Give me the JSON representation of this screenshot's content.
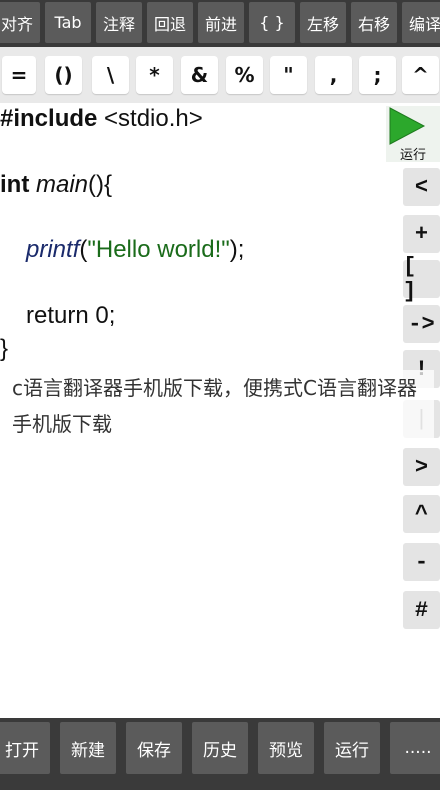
{
  "toolbar": {
    "items": [
      "对齐",
      "Tab",
      "注释",
      "回退",
      "前进",
      "{ }",
      "左移",
      "右移",
      "编译"
    ]
  },
  "symbols": [
    "=",
    "()",
    "\\",
    "*",
    "&",
    "%",
    "\"",
    ",",
    ";",
    "^"
  ],
  "code": {
    "line1_kw": "#include",
    "line1_rest": " <stdio.h>",
    "line2_kw": "int",
    "line2_fn": " main",
    "line2_rest": "(){",
    "line3_fn": "printf",
    "line3_open": "(",
    "line3_str": "\"Hello world!\"",
    "line3_close": ");",
    "line4": "return 0;",
    "line5": "}"
  },
  "run": {
    "label": "运行"
  },
  "right_keys": [
    "<",
    "+",
    "[ ]",
    "->",
    "!",
    "|",
    ">",
    "^",
    "-",
    "#"
  ],
  "caption": "c语言翻译器手机版下载，便携式C语言翻译器手机版下载",
  "bottom": {
    "items": [
      "打开",
      "新建",
      "保存",
      "历史",
      "预览",
      "运行",
      "....."
    ]
  },
  "colors": {
    "toolbar_bg": "#3a3a3a",
    "button_bg": "#5b5b5b",
    "run_icon": "#2ca82c",
    "string_green": "#1a6b1a"
  }
}
